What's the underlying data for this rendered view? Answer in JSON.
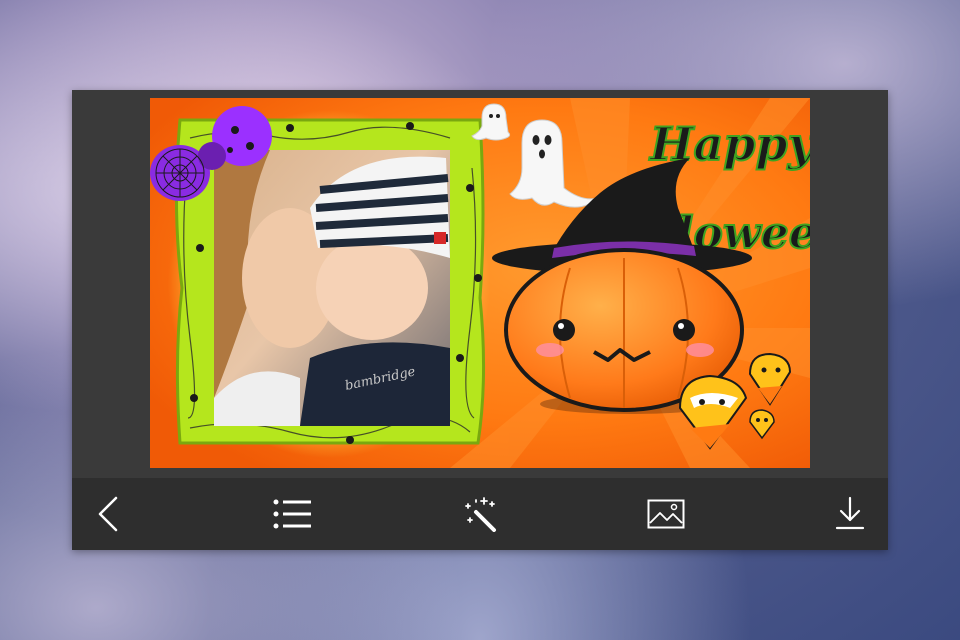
{
  "canvas": {
    "greeting_line1": "Happy",
    "greeting_line2": "Halloween",
    "baby_shirt_text": "bambridge",
    "colors": {
      "background_orange": "#ff7a12",
      "frame_green": "#b5e61d",
      "text_green": "#3b7d1a",
      "pumpkin_orange": "#ff7a1a",
      "bow_purple": "#8a2be2"
    }
  },
  "toolbar": {
    "buttons": [
      {
        "name": "back",
        "icon": "chevron-left-icon"
      },
      {
        "name": "frames",
        "icon": "list-icon"
      },
      {
        "name": "effects",
        "icon": "magic-wand-icon"
      },
      {
        "name": "gallery",
        "icon": "image-icon"
      },
      {
        "name": "save",
        "icon": "download-icon"
      }
    ]
  }
}
